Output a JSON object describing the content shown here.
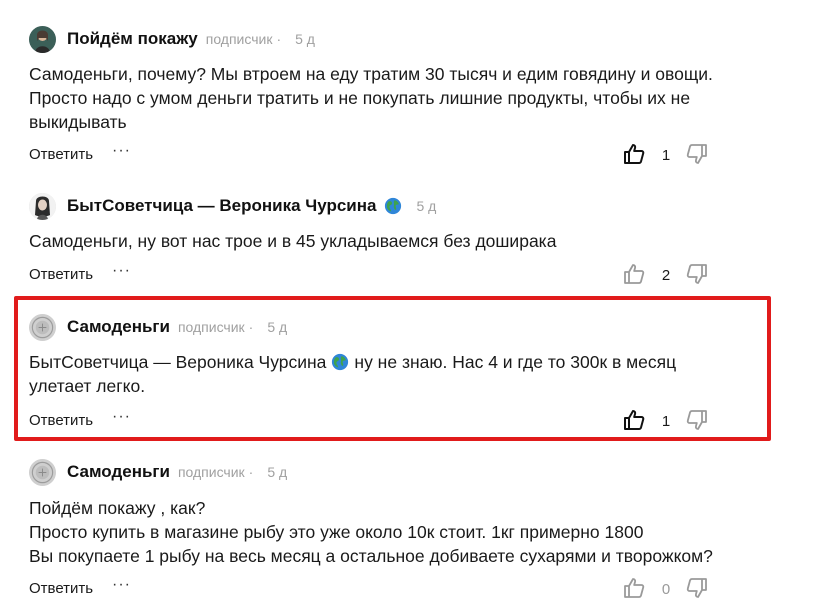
{
  "comments": [
    {
      "author": "Пойдём покажу",
      "role": "подписчик",
      "dot": "·",
      "time": "5 д",
      "lines": [
        "Самоденьги, почему? Мы втроем на еду тратим 30 тысяч и едим говядину и овощи.",
        "Просто надо с умом деньги тратить и не покупать лишние продукты, чтобы их не",
        "выкидывать"
      ],
      "reply_label": "Ответить",
      "more_label": "···",
      "likes": "1",
      "liked": true
    },
    {
      "author": "БытСоветчица — Вероника Чурсина",
      "badge_icon": "globe-icon",
      "time": "5 д",
      "lines": [
        "Самоденьги, ну вот нас трое и в 45 укладываемся без доширака"
      ],
      "reply_label": "Ответить",
      "more_label": "···",
      "likes": "2",
      "liked": false
    },
    {
      "author": "Самоденьги",
      "role": "подписчик",
      "dot": "·",
      "time": "5 д",
      "mention": "БытСоветчица — Вероника Чурсина",
      "line1_rest": "ну не знаю. Нас 4 и где то 300к в месяц",
      "line2": "улетает легко.",
      "reply_label": "Ответить",
      "more_label": "···",
      "likes": "1",
      "liked": true,
      "highlighted": true
    },
    {
      "author": "Самоденьги",
      "role": "подписчик",
      "dot": "·",
      "time": "5 д",
      "lines": [
        "Пойдём покажу , как?",
        "Просто купить в магазине рыбу это уже около 10к стоит. 1кг примерно 1800",
        "Вы покупаете 1 рыбу на весь месяц а остальное добиваете сухарями и творожком?"
      ],
      "reply_label": "Ответить",
      "more_label": "···",
      "likes": "0",
      "liked": false
    }
  ],
  "colors": {
    "highlight_border": "#e11b1b",
    "meta_text": "#a0a0a0",
    "body_text": "#1a1a1a"
  }
}
